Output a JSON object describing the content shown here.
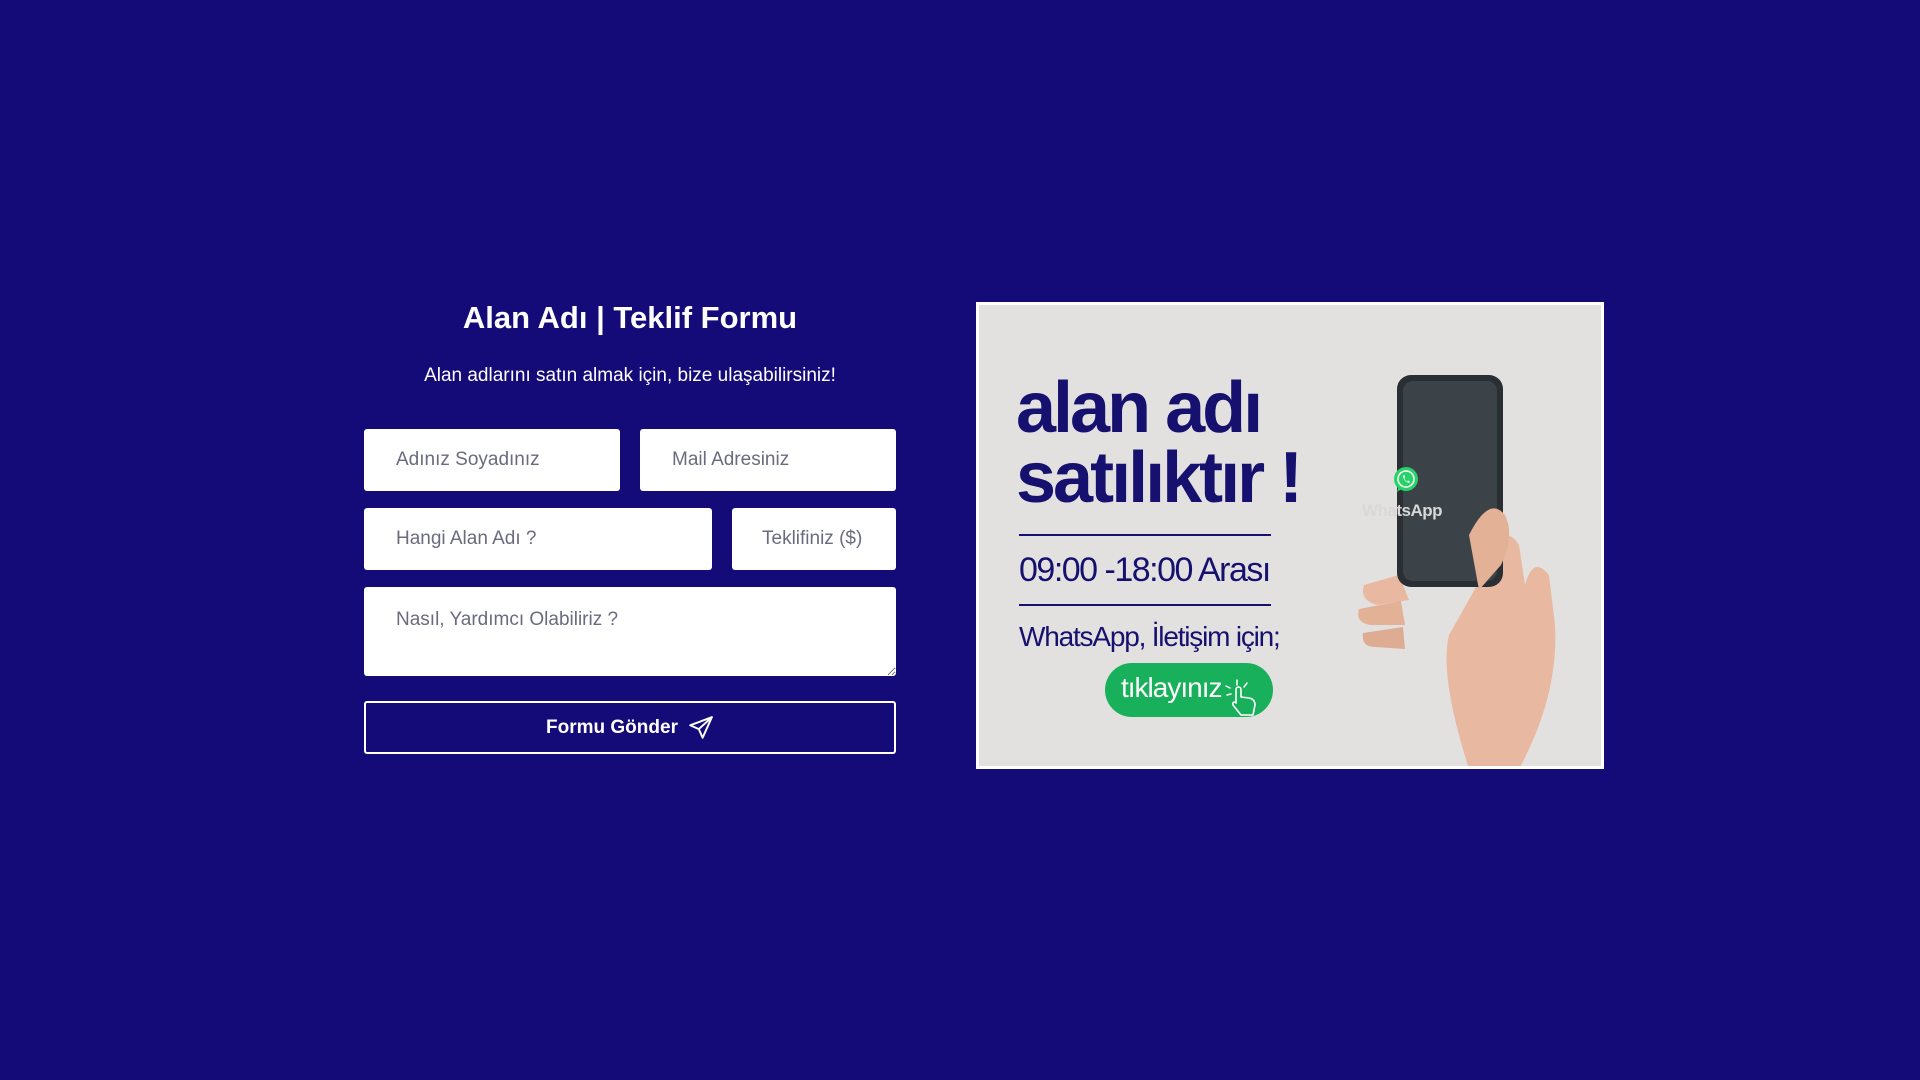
{
  "form": {
    "title": "Alan Adı | Teklif Formu",
    "subtitle": "Alan adlarını satın almak için, bize ulaşabilirsiniz!",
    "name_placeholder": "Adınız Soyadınız",
    "email_placeholder": "Mail Adresiniz",
    "domain_placeholder": "Hangi Alan Adı ?",
    "offer_placeholder": "Teklifiniz ($)",
    "message_placeholder": "Nasıl, Yardımcı Olabiliriz ?",
    "submit_label": "Formu Gönder",
    "submit_icon": "paper-plane-icon"
  },
  "banner": {
    "title_line1": "alan adı",
    "title_line2": "satılıktır !",
    "hours": "09:00 -18:00 Arası",
    "contact_text": "WhatsApp, İletişim için;",
    "cta_label": "tıklayınız",
    "phone_app_label": "WhatsApp",
    "colors": {
      "text": "#16106e",
      "cta": "#18b05a",
      "background": "#e3e1e0"
    }
  },
  "theme": {
    "page_background": "#140a78",
    "field_background": "#ffffff"
  }
}
